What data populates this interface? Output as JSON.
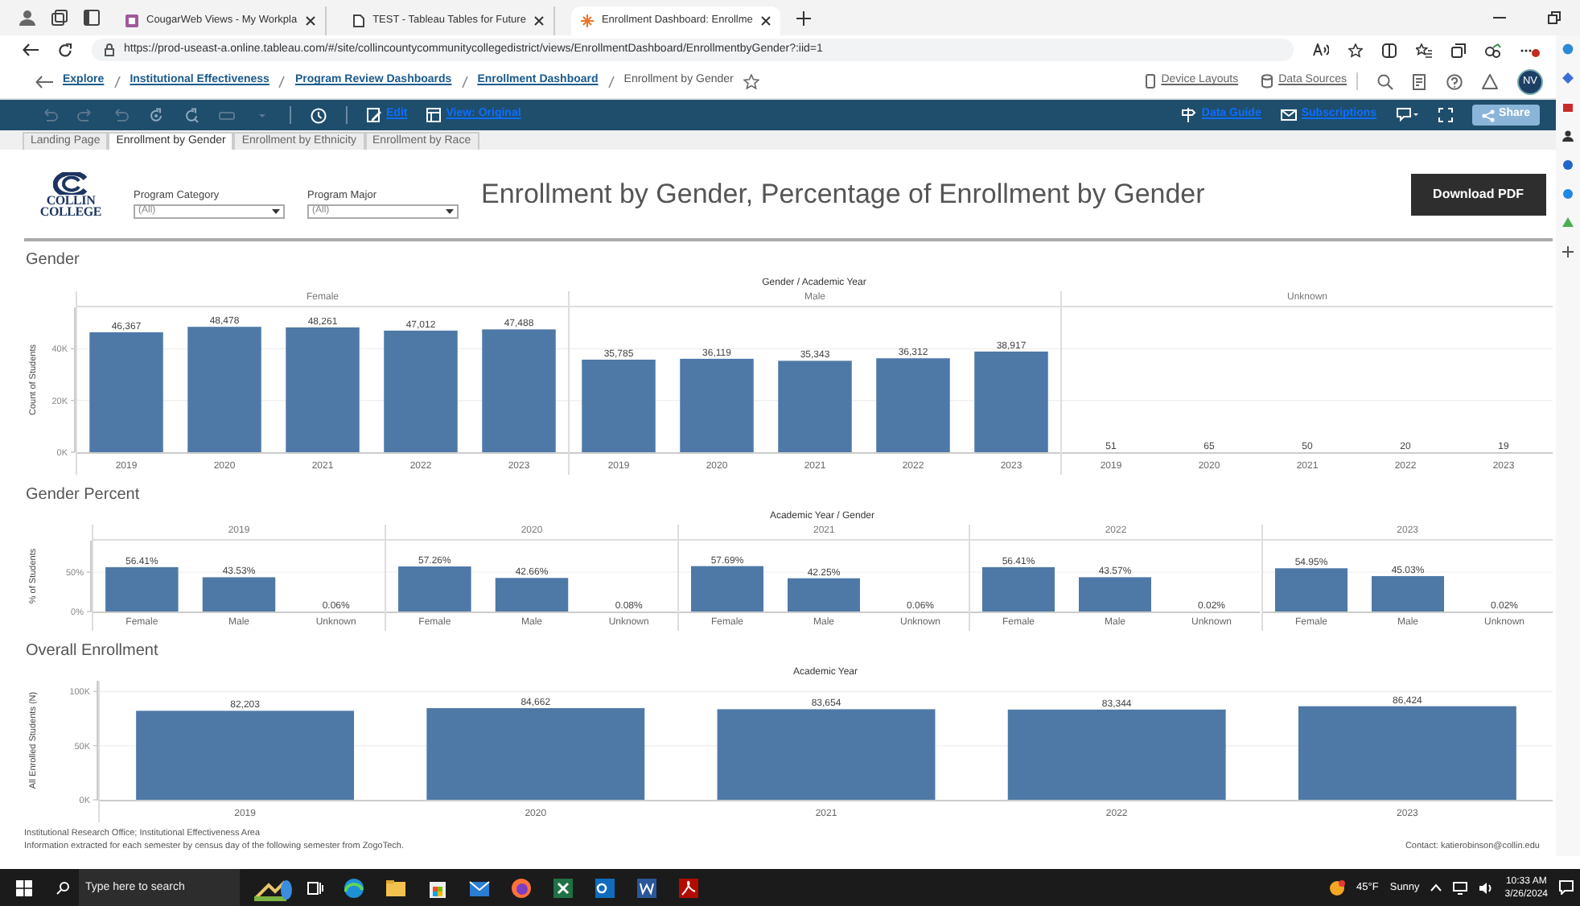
{
  "browser": {
    "tabs": [
      {
        "title": "CougarWeb Views - My Workpla",
        "selected": false
      },
      {
        "title": "TEST - Tableau Tables for Future",
        "selected": false
      },
      {
        "title": "Enrollment Dashboard: Enrollme",
        "selected": true
      }
    ],
    "url": "https://prod-useast-a.online.tableau.com/#/site/collincountycommunitycollegedistrict/views/EnrollmentDashboard/EnrollmentbyGender?:iid=1"
  },
  "breadcrumbs": [
    {
      "label": "Explore",
      "kind": "link"
    },
    {
      "label": "Institutional Effectiveness",
      "kind": "link"
    },
    {
      "label": "Program Review Dashboards",
      "kind": "link"
    },
    {
      "label": "Enrollment Dashboard",
      "kind": "link"
    },
    {
      "label": "Enrollment by Gender",
      "kind": "current"
    }
  ],
  "site_actions": [
    "Device Layouts",
    "Data Sources"
  ],
  "user_initials": "NV",
  "toolbar": {
    "left": [
      "Edit",
      "View: Original"
    ],
    "right": [
      "Data Guide",
      "Subscriptions"
    ],
    "share": "Share"
  },
  "sheet_tabs": [
    {
      "label": "Landing Page",
      "selected": false
    },
    {
      "label": "Enrollment by Gender",
      "selected": true
    },
    {
      "label": "Enrollment by Ethnicity",
      "selected": false
    },
    {
      "label": "Enrollment by Race",
      "selected": false
    }
  ],
  "dashboard": {
    "logo_text": [
      "COLLIN",
      "COLLEGE"
    ],
    "filters": [
      {
        "label": "Program Category",
        "value": "(All)"
      },
      {
        "label": "Program Major",
        "value": "(All)"
      }
    ],
    "title": "Enrollment by Gender, Percentage of Enrollment by Gender",
    "download_button": "Download PDF",
    "sections": [
      {
        "title": "Gender",
        "header": "Gender / Academic Year",
        "panels": [
          {
            "label": "Female",
            "chart_data": {
              "type": "bar",
              "ylabel": "Count of Students",
              "categories": [
                "2019",
                "2020",
                "2021",
                "2022",
                "2023"
              ],
              "values": [
                46367,
                48478,
                48261,
                47012,
                47488
              ],
              "value_labels": [
                "46,367",
                "48,478",
                "48,261",
                "47,012",
                "47,488"
              ],
              "ylim": [
                0,
                56000
              ],
              "yticks": [
                {
                  "value": 0,
                  "label": "0K"
                },
                {
                  "value": 20000,
                  "label": "20K"
                },
                {
                  "value": 40000,
                  "label": "40K"
                }
              ]
            }
          },
          {
            "label": "Male",
            "chart_data": {
              "type": "bar",
              "categories": [
                "2019",
                "2020",
                "2021",
                "2022",
                "2023"
              ],
              "values": [
                35785,
                36119,
                35343,
                36312,
                38917
              ],
              "value_labels": [
                "35,785",
                "36,119",
                "35,343",
                "36,312",
                "38,917"
              ],
              "ylim": [
                0,
                56000
              ]
            }
          },
          {
            "label": "Unknown",
            "chart_data": {
              "type": "bar",
              "categories": [
                "2019",
                "2020",
                "2021",
                "2022",
                "2023"
              ],
              "values": [
                51,
                65,
                50,
                20,
                19
              ],
              "value_labels": [
                "51",
                "65",
                "50",
                "20",
                "19"
              ],
              "ylim": [
                0,
                56000
              ]
            }
          }
        ]
      },
      {
        "title": "Gender Percent",
        "header": "Academic Year / Gender",
        "panels": [
          {
            "label": "2019",
            "chart_data": {
              "type": "bar",
              "ylabel": "% of Students",
              "categories": [
                "Female",
                "Male",
                "Unknown"
              ],
              "values": [
                56.41,
                43.53,
                0.06
              ],
              "value_labels": [
                "56.41%",
                "43.53%",
                "0.06%"
              ],
              "ylim": [
                0,
                90
              ],
              "yticks": [
                {
                  "value": 0,
                  "label": "0%"
                },
                {
                  "value": 50,
                  "label": "50%"
                }
              ]
            }
          },
          {
            "label": "2020",
            "chart_data": {
              "type": "bar",
              "categories": [
                "Female",
                "Male",
                "Unknown"
              ],
              "values": [
                57.26,
                42.66,
                0.08
              ],
              "value_labels": [
                "57.26%",
                "42.66%",
                "0.08%"
              ],
              "ylim": [
                0,
                90
              ]
            }
          },
          {
            "label": "2021",
            "chart_data": {
              "type": "bar",
              "categories": [
                "Female",
                "Male",
                "Unknown"
              ],
              "values": [
                57.69,
                42.25,
                0.06
              ],
              "value_labels": [
                "57.69%",
                "42.25%",
                "0.06%"
              ],
              "ylim": [
                0,
                90
              ]
            }
          },
          {
            "label": "2022",
            "chart_data": {
              "type": "bar",
              "categories": [
                "Female",
                "Male",
                "Unknown"
              ],
              "values": [
                56.41,
                43.57,
                0.02
              ],
              "value_labels": [
                "56.41%",
                "43.57%",
                "0.02%"
              ],
              "ylim": [
                0,
                90
              ]
            }
          },
          {
            "label": "2023",
            "chart_data": {
              "type": "bar",
              "categories": [
                "Female",
                "Male",
                "Unknown"
              ],
              "values": [
                54.95,
                45.03,
                0.02
              ],
              "value_labels": [
                "54.95%",
                "45.03%",
                "0.02%"
              ],
              "ylim": [
                0,
                90
              ]
            }
          }
        ]
      },
      {
        "title": "Overall Enrollment",
        "header": "Academic Year",
        "panels": [
          {
            "chart_data": {
              "type": "bar",
              "ylabel": "All Enrolled Students (N)",
              "categories": [
                "2019",
                "2020",
                "2021",
                "2022",
                "2023"
              ],
              "values": [
                82203,
                84662,
                83654,
                83344,
                86424
              ],
              "value_labels": [
                "82,203",
                "84,662",
                "83,654",
                "83,344",
                "86,424"
              ],
              "ylim": [
                0,
                110000
              ],
              "yticks": [
                {
                  "value": 0,
                  "label": "0K"
                },
                {
                  "value": 50000,
                  "label": "50K"
                },
                {
                  "value": 100000,
                  "label": "100K"
                }
              ]
            }
          }
        ]
      }
    ],
    "footer_lines": [
      "Institutional Research Office; Institutional Effectiveness Area",
      "Information extracted for each semester by census day of the following semester from ZogoTech."
    ],
    "contact": "Contact: katierobinson@collin.edu"
  },
  "taskbar": {
    "search_placeholder": "Type here to search",
    "temperature": "45°F",
    "weather": "Sunny",
    "time": "10:33 AM",
    "date": "3/26/2024"
  }
}
